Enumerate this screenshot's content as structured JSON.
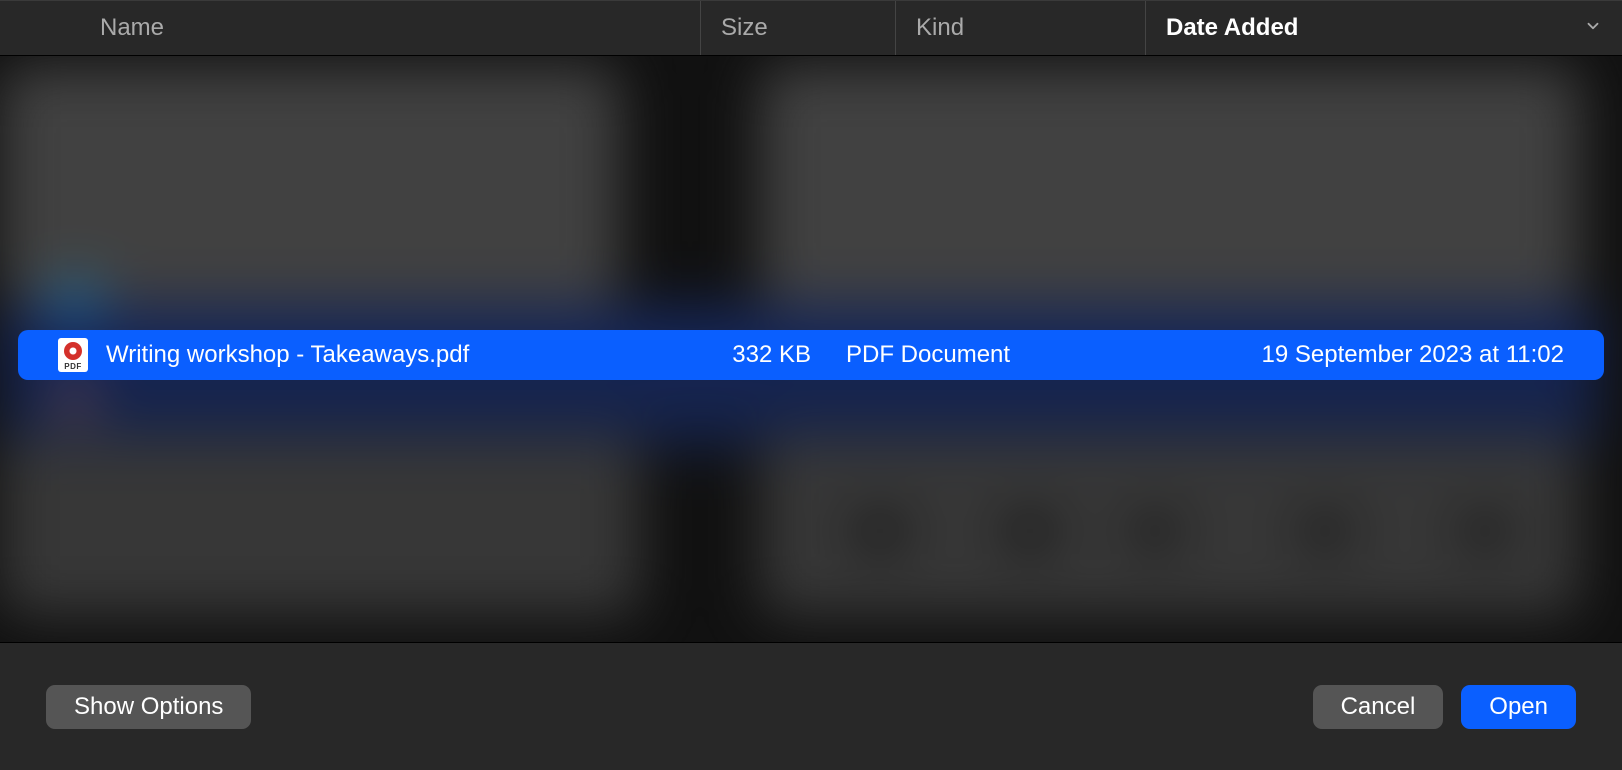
{
  "columns": {
    "name": "Name",
    "size": "Size",
    "kind": "Kind",
    "date_added": "Date Added"
  },
  "sort": {
    "active_column": "date_added",
    "direction": "descending"
  },
  "files": [
    {
      "icon": "pdf-file-icon",
      "name": "Writing workshop - Takeaways.pdf",
      "size": "332 KB",
      "kind": "PDF Document",
      "date_added": "19 September 2023 at 11:02",
      "selected": true
    }
  ],
  "buttons": {
    "show_options": "Show Options",
    "cancel": "Cancel",
    "open": "Open"
  },
  "colors": {
    "selection": "#0a5fff",
    "primary_button": "#0a5fff",
    "secondary_button": "#555555",
    "background": "#282828"
  }
}
